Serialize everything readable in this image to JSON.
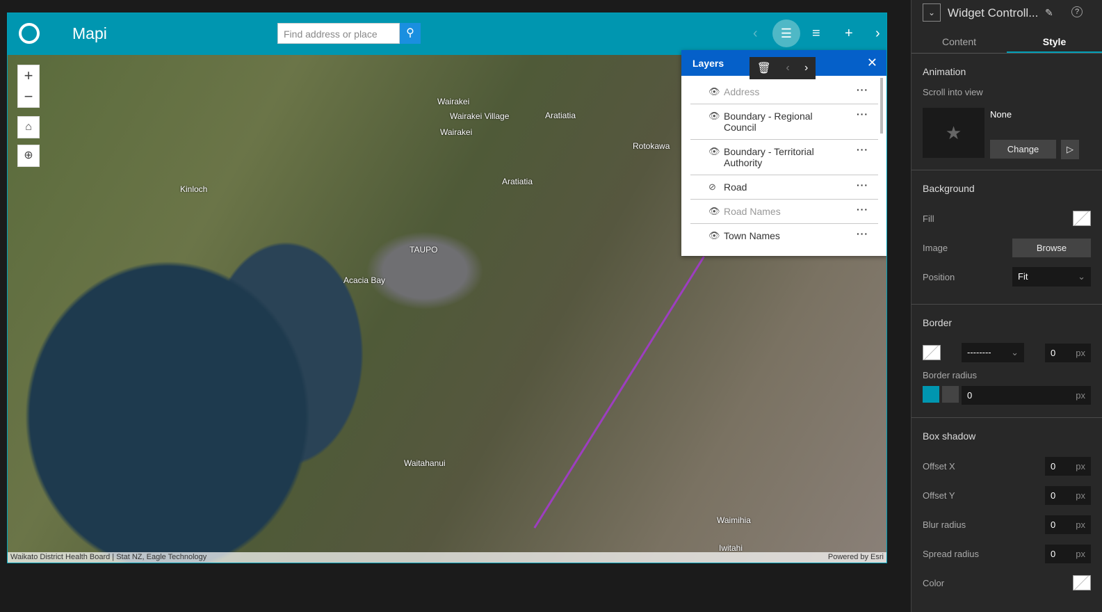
{
  "header": {
    "title": "Mapi",
    "search_placeholder": "Find address or place"
  },
  "map": {
    "labels": [
      "Wairakei",
      "Wairakei Village",
      "Wairakei",
      "Aratiatia",
      "Rotokawa",
      "Aratiatia",
      "Kinloch",
      "TAUPO",
      "Acacia Bay",
      "Waitahanui",
      "Waimihia",
      "Iwitahi"
    ],
    "attribution": "Waikato District Health Board | Stat NZ, Eagle Technology",
    "powered": "Powered by Esri"
  },
  "layers": {
    "title": "Layers",
    "items": [
      {
        "name": "Address",
        "visible": true,
        "dim": true
      },
      {
        "name": "Boundary - Regional Council",
        "visible": true
      },
      {
        "name": "Boundary - Territorial Authority",
        "visible": true
      },
      {
        "name": "Road",
        "visible": false
      },
      {
        "name": "Road Names",
        "visible": true,
        "dim": true
      },
      {
        "name": "Town Names",
        "visible": true
      }
    ]
  },
  "panel": {
    "title": "Widget Controll...",
    "tabs": [
      "Content",
      "Style"
    ],
    "animation": {
      "title": "Animation",
      "scroll_label": "Scroll into view",
      "effect": "None",
      "change": "Change"
    },
    "background": {
      "title": "Background",
      "fill": "Fill",
      "image": "Image",
      "browse": "Browse",
      "position": "Position",
      "position_value": "Fit"
    },
    "border": {
      "title": "Border",
      "style": "--------",
      "width": "0",
      "unit": "px",
      "radius_label": "Border radius",
      "radius": "0"
    },
    "shadow": {
      "title": "Box shadow",
      "rows": [
        {
          "label": "Offset X",
          "value": "0"
        },
        {
          "label": "Offset Y",
          "value": "0"
        },
        {
          "label": "Blur radius",
          "value": "0"
        },
        {
          "label": "Spread radius",
          "value": "0"
        }
      ],
      "color": "Color",
      "unit": "px"
    }
  }
}
